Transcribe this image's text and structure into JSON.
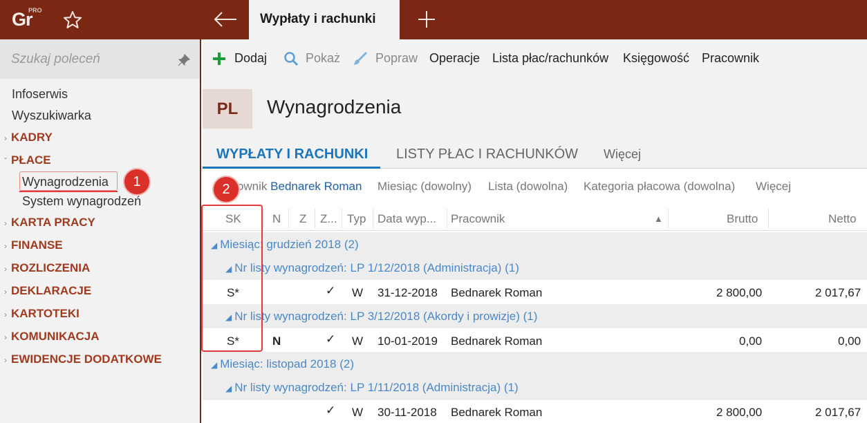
{
  "app": {
    "logo_text": "Gr",
    "logo_badge": "PRO",
    "active_tab": "Wypłaty i rachunki"
  },
  "sidebar": {
    "search_placeholder": "Szukaj poleceń",
    "top_items": [
      "Infoserwis",
      "Wyszukiwarka"
    ],
    "sections": [
      {
        "label": "KADRY",
        "expanded": false
      },
      {
        "label": "PŁACE",
        "expanded": true
      },
      {
        "label": "KARTA PRACY",
        "expanded": false
      },
      {
        "label": "FINANSE",
        "expanded": false
      },
      {
        "label": "ROZLICZENIA",
        "expanded": false
      },
      {
        "label": "DEKLARACJE",
        "expanded": false
      },
      {
        "label": "KARTOTEKI",
        "expanded": false
      },
      {
        "label": "KOMUNIKACJA",
        "expanded": false
      },
      {
        "label": "EWIDENCJE DODATKOWE",
        "expanded": false
      }
    ],
    "place_items": [
      "Wynagrodzenia",
      "System wynagrodzeń"
    ]
  },
  "badges": {
    "one": "1",
    "two": "2"
  },
  "toolbar": {
    "add": "Dodaj",
    "show": "Pokaż",
    "edit": "Popraw",
    "operations": "Operacje",
    "payroll_list": "Lista płac/rachunków",
    "accounting": "Księgowość",
    "employee": "Pracownik"
  },
  "header": {
    "code": "PL",
    "title": "Wynagrodzenia"
  },
  "tabs": {
    "t1": "WYPŁATY I RACHUNKI",
    "t2": "LISTY PŁAC I RACHUNKÓW",
    "t3": "Więcej"
  },
  "filters": {
    "employee_label": "Pracownik",
    "employee_value": "Bednarek Roman",
    "month": "Miesiąc (dowolny)",
    "list": "Lista (dowolna)",
    "category": "Kategoria płacowa (dowolna)",
    "more": "Więcej"
  },
  "columns": {
    "sk": "SK",
    "n": "N",
    "z": "Z",
    "z2": "Z...",
    "typ": "Typ",
    "date": "Data wyp...",
    "employee": "Pracownik",
    "brutto": "Brutto",
    "netto": "Netto"
  },
  "rows": {
    "g1": {
      "prefix": "Miesiąc:",
      "value": "grudzień 2018",
      "count": "(2)"
    },
    "g1a": {
      "prefix": "Nr listy wynagrodzeń:",
      "value": "LP 1/12/2018 (Administracja)",
      "count": "(1)"
    },
    "r1": {
      "sk": "S*",
      "n": "",
      "check": "✓",
      "typ": "W",
      "date": "31-12-2018",
      "employee": "Bednarek Roman",
      "brutto": "2 800,00",
      "netto": "2 017,67"
    },
    "g1b": {
      "prefix": "Nr listy wynagrodzeń:",
      "value": "LP 3/12/2018 (Akordy i prowizje)",
      "count": "(1)"
    },
    "r2": {
      "sk": "S*",
      "n": "N",
      "check": "✓",
      "typ": "W",
      "date": "10-01-2019",
      "employee": "Bednarek Roman",
      "brutto": "0,00",
      "netto": "0,00"
    },
    "g2": {
      "prefix": "Miesiąc:",
      "value": "listopad 2018",
      "count": "(2)"
    },
    "g2a": {
      "prefix": "Nr listy wynagrodzeń:",
      "value": "LP 1/11/2018 (Administracja)",
      "count": "(1)"
    },
    "r3": {
      "sk": "",
      "n": "",
      "check": "✓",
      "typ": "W",
      "date": "30-11-2018",
      "employee": "Bednarek Roman",
      "brutto": "2 800,00",
      "netto": "2 017,67"
    }
  },
  "colors": {
    "topbar": "#7a2713",
    "accent_blue": "#1b75bb",
    "section_red": "#a03a1e",
    "annotation_red": "#d9302a"
  }
}
